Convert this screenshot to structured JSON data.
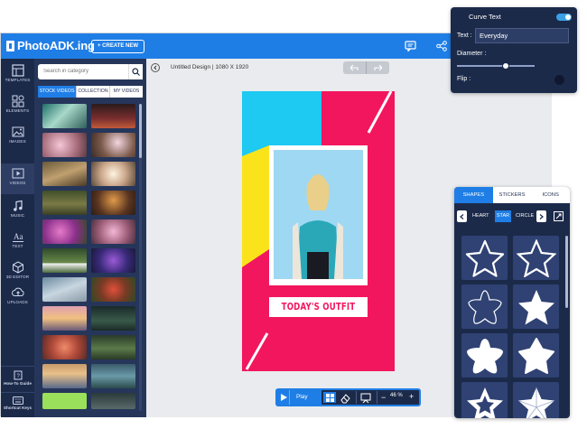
{
  "app": {
    "logo_text": "PhotoADK.ing",
    "create_button": "+ CREATE NEW"
  },
  "iconbar": {
    "items": [
      {
        "label": "TEMPLATES",
        "icon": "templates-icon"
      },
      {
        "label": "ELEMENTS",
        "icon": "elements-icon"
      },
      {
        "label": "IMAGES",
        "icon": "images-icon"
      },
      {
        "label": "VIDEOS",
        "icon": "videos-icon"
      },
      {
        "label": "MUSIC",
        "icon": "music-icon"
      },
      {
        "label": "TEXT",
        "icon": "text-icon"
      },
      {
        "label": "3D EDITOR",
        "icon": "3d-editor-icon"
      },
      {
        "label": "UPLOADS",
        "icon": "uploads-icon"
      }
    ],
    "bottom": [
      {
        "label": "How-To Guide",
        "icon": "guide-icon"
      },
      {
        "label": "Shortcut Keys",
        "icon": "keyboard-icon"
      }
    ]
  },
  "panel": {
    "search_placeholder": "Search in category",
    "tabs": [
      "STOCK VIDEOS",
      "COLLECTION",
      "MY VIDEOS"
    ]
  },
  "design": {
    "title": "Untitled Design | 1080 X 1920",
    "poster_text": "TODAY'S OUTFIT"
  },
  "playback": {
    "play_label": "Play",
    "zoom": "46 %"
  },
  "curve_text": {
    "title": "Curve Text",
    "text_label": "Text :",
    "text_value": "Everyday",
    "diameter_label": "Diameter :",
    "flip_label": "Flip :"
  },
  "shapes_panel": {
    "tabs": [
      "SHAPES",
      "STICKERS",
      "ICONS"
    ],
    "categories": [
      "HEART",
      "STAR",
      "CIRCLE"
    ]
  }
}
